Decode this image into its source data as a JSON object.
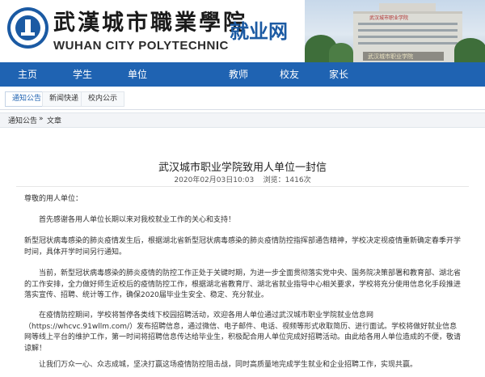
{
  "header": {
    "school_name_cn": "武漢城市職業學院",
    "school_name_en": "WUHAN CITY POLYTECHNIC",
    "site_name": "就业网",
    "banner_sign": "武汉城市职业学院",
    "banner_stone": "武汉城市职业学院"
  },
  "nav": {
    "items": [
      {
        "label": "主页"
      },
      {
        "label": "学生"
      },
      {
        "label": "单位"
      },
      {
        "label": "教师"
      },
      {
        "label": "校友"
      },
      {
        "label": "家长"
      }
    ]
  },
  "subtabs": [
    {
      "label": "通知公告"
    },
    {
      "label": "新闻快递"
    },
    {
      "label": "校内公示"
    }
  ],
  "breadcrumb": {
    "section": "通知公告",
    "separator": "»",
    "current": "文章"
  },
  "article": {
    "title": "武汉城市职业学院致用人单位一封信",
    "date": "2020年02月03日10:03",
    "views_label": "浏览：",
    "views": "1416次",
    "greeting": "尊敬的用人单位：",
    "paragraphs": [
      "首先感谢各用人单位长期以来对我校就业工作的关心和支持！",
      "新型冠状病毒感染的肺炎疫情发生后，根据湖北省新型冠状病毒感染的肺炎疫情防控指挥部通告精神，学校决定视疫情重新确定春季开学时间，具体开学时间另行通知。",
      "当前，新型冠状病毒感染的肺炎疫情的防控工作正处于关键时期，为进一步全面贯彻落实党中央、国务院决策部署和教育部、湖北省的工作安排，全力做好师生近校后的疫情防控工作，根据湖北省教育厅、湖北省就业指导中心相关要求，学校将充分使用信息化手段推进落实宣传、招聘、统计等工作，确保2020届毕业生安全、稳定、充分就业。",
      "在疫情防控期间，学校将暂停各类线下校园招聘活动，欢迎各用人单位通过武汉城市职业学院就业信息网（https://whcvc.91wllm.com/）发布招聘信息，通过微信、电子邮件、电话、视频等形式收取简历、进行面试。学校将做好就业信息网等线上平台的维护工作，第一时间将招聘信息传达给毕业生，积极配合用人单位完成好招聘活动。由此给各用人单位造成的不便，敬请谅解！",
      "让我们万众一心、众志成城，坚决打赢这场疫情防控阻击战，同时高质量地完成学生就业和企业招聘工作，实现共赢。"
    ]
  },
  "colors": {
    "nav_bg": "#1f63b2",
    "brand_blue": "#1b5aa3"
  },
  "icons": {
    "logo": "school-emblem"
  }
}
